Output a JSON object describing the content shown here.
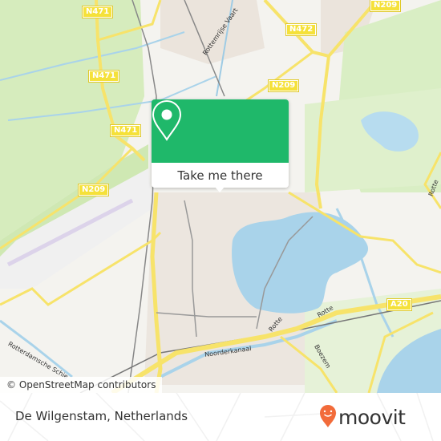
{
  "map": {
    "road_labels": [
      {
        "id": "n471-top",
        "text": "N471"
      },
      {
        "id": "n471-mid",
        "text": "N471"
      },
      {
        "id": "n471-low",
        "text": "N471"
      },
      {
        "id": "n472",
        "text": "N472"
      },
      {
        "id": "n209-top",
        "text": "N209"
      },
      {
        "id": "n209-mid",
        "text": "N209"
      },
      {
        "id": "n209-left",
        "text": "N209"
      },
      {
        "id": "a20",
        "text": "A20"
      }
    ],
    "water_labels": [
      {
        "id": "rottemeren-vaart",
        "text": "Rottemrijse Vaart"
      },
      {
        "id": "rotterdamsche-schie",
        "text": "Rotterdamsche Schie"
      },
      {
        "id": "noorderkanaal",
        "text": "Noorderkanaal"
      },
      {
        "id": "rotte-1",
        "text": "Rotte"
      },
      {
        "id": "rotte-2",
        "text": "Rotte"
      },
      {
        "id": "rotte-3",
        "text": "Rotte"
      },
      {
        "id": "boezem",
        "text": "Boezem"
      }
    ],
    "colors": {
      "water": "#a9d3ea",
      "park": "#cfeab0",
      "road_major": "#f7e36a",
      "urban": "#ece6df"
    }
  },
  "popup": {
    "button_label": "Take me there",
    "icon": "map-pin-icon",
    "color": "#1fb86a"
  },
  "attribution": "© OpenStreetMap contributors",
  "footer": {
    "place_name": "De Wilgenstam, Netherlands",
    "logo_text": "moovit",
    "logo_color": "#f26b3a"
  }
}
